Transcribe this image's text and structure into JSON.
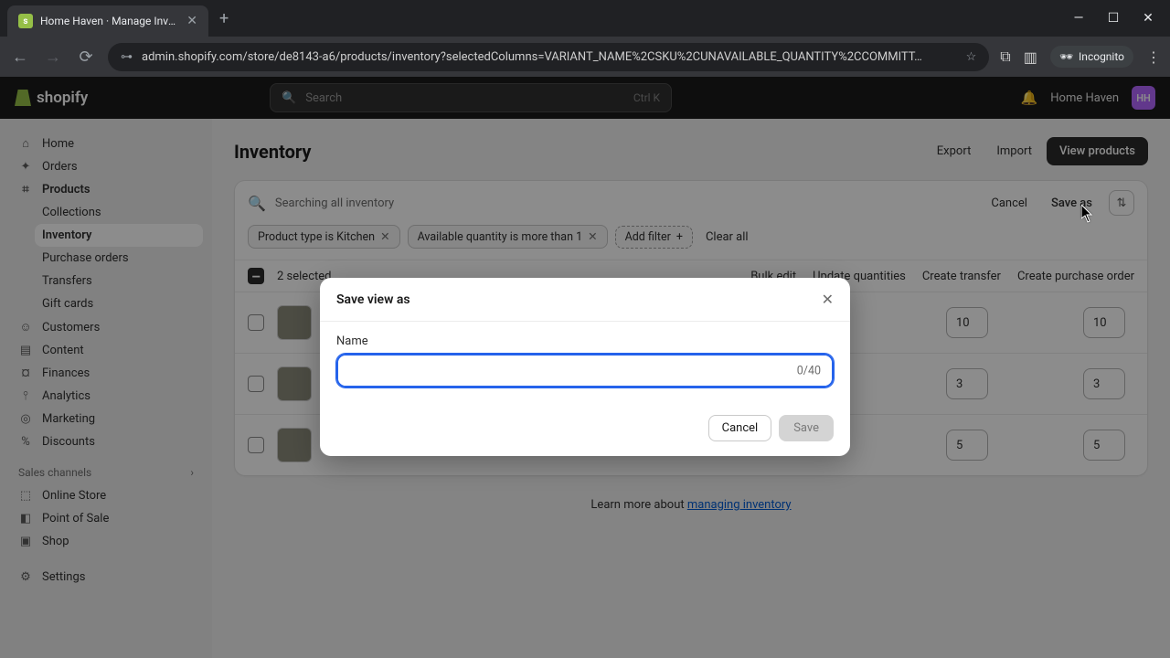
{
  "browser": {
    "tab_title": "Home Haven · Manage Invento",
    "url": "admin.shopify.com/store/de8143-a6/products/inventory?selectedColumns=VARIANT_NAME%2CSKU%2CUNAVAILABLE_QUANTITY%2CCOMMITT…",
    "incognito": "Incognito"
  },
  "topbar": {
    "brand": "shopify",
    "search_placeholder": "Search",
    "search_shortcut": "Ctrl K",
    "store_name": "Home Haven",
    "store_initials": "HH"
  },
  "sidebar": {
    "items": [
      {
        "icon": "⌂",
        "label": "Home"
      },
      {
        "icon": "✦",
        "label": "Orders"
      },
      {
        "icon": "⌗",
        "label": "Products"
      }
    ],
    "sub_products": [
      {
        "label": "Collections"
      },
      {
        "label": "Inventory",
        "active": true
      },
      {
        "label": "Purchase orders"
      },
      {
        "label": "Transfers"
      },
      {
        "label": "Gift cards"
      }
    ],
    "items2": [
      {
        "icon": "☺",
        "label": "Customers"
      },
      {
        "icon": "▤",
        "label": "Content"
      },
      {
        "icon": "¤",
        "label": "Finances"
      },
      {
        "icon": "⫯",
        "label": "Analytics"
      },
      {
        "icon": "◎",
        "label": "Marketing"
      },
      {
        "icon": "%",
        "label": "Discounts"
      }
    ],
    "channels_label": "Sales channels",
    "channels": [
      {
        "icon": "⬚",
        "label": "Online Store"
      },
      {
        "icon": "◧",
        "label": "Point of Sale"
      },
      {
        "icon": "▣",
        "label": "Shop"
      }
    ],
    "settings": {
      "icon": "⚙",
      "label": "Settings"
    }
  },
  "page": {
    "title": "Inventory",
    "export": "Export",
    "import": "Import",
    "view_products": "View products"
  },
  "filters": {
    "search_text": "Searching all inventory",
    "cancel": "Cancel",
    "save_as": "Save as",
    "chips": [
      "Product type is Kitchen",
      "Available quantity is more than 1"
    ],
    "add_filter": "Add filter",
    "clear_all": "Clear all"
  },
  "bulk": {
    "selected": "2 selected",
    "actions": [
      "Bulk edit",
      "Update quantities",
      "Create transfer",
      "Create purchase order"
    ]
  },
  "rows": [
    {
      "q1": "10",
      "q2": "10"
    },
    {
      "q1": "3",
      "q2": "3"
    },
    {
      "q1": "5",
      "q2": "5"
    }
  ],
  "footer": {
    "learn_prefix": "Learn more about ",
    "learn_link": "managing inventory"
  },
  "modal": {
    "title": "Save view as",
    "name_label": "Name",
    "char_count": "0/40",
    "cancel": "Cancel",
    "save": "Save"
  }
}
